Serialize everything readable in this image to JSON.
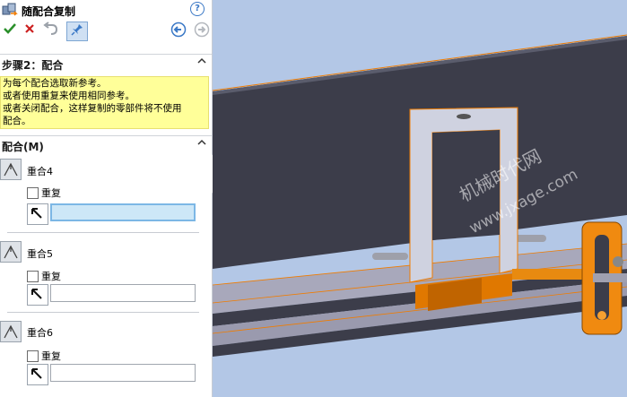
{
  "panel": {
    "title": "随配合复制",
    "help_label": "?",
    "step_header": "步骤2：配合",
    "message_lines": [
      "为每个配合选取新参考。",
      "或者使用重复来使用相同参考。",
      "或者关闭配合，这样复制的零部件将不使用",
      "配合。"
    ],
    "mates_header": "配合(M)",
    "mates": [
      {
        "name": "重合4",
        "repeat_label": "重复",
        "repeat_checked": false,
        "reference_value": ""
      },
      {
        "name": "重合5",
        "repeat_label": "重复",
        "repeat_checked": false,
        "reference_value": ""
      },
      {
        "name": "重合6",
        "repeat_label": "重复",
        "repeat_checked": false,
        "reference_value": ""
      }
    ]
  },
  "toolbar": {
    "ok_icon": "check-icon",
    "cancel_icon": "close-icon",
    "undo_icon": "undo-icon",
    "pin_icon": "pushpin-icon",
    "back_icon": "back-arrow-icon",
    "next_icon": "next-arrow-icon"
  },
  "viewport": {
    "watermark_line1": "机械时代网",
    "watermark_line2": "www.jxage.com"
  },
  "colors": {
    "accent": "#f07c00",
    "viewport_bg": "#b3c7e6",
    "message_bg": "#ffff99",
    "ok_green": "#2a8f2a",
    "cancel_red": "#cc2020"
  }
}
